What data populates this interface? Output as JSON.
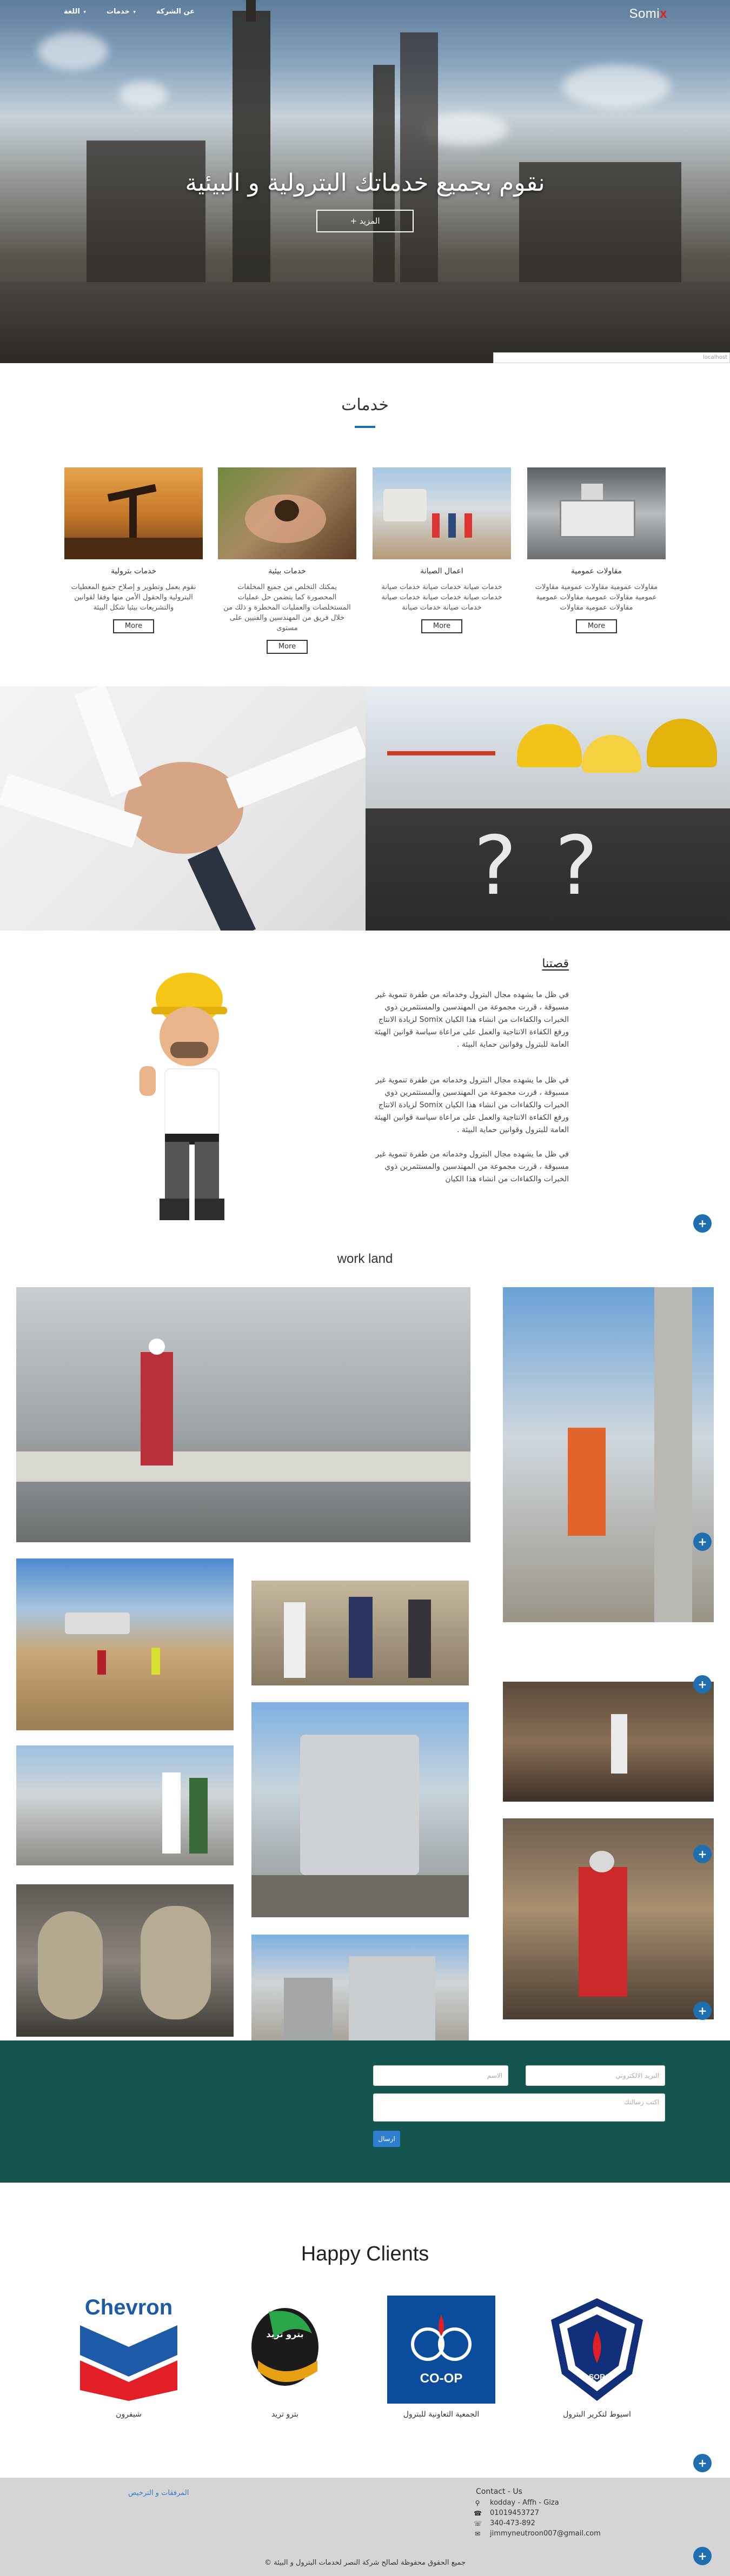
{
  "nav": {
    "items": [
      {
        "label": "اللغة",
        "caret": "▾"
      },
      {
        "label": "خدمات",
        "caret": "▾"
      },
      {
        "label": "عن الشركة",
        "caret": ""
      }
    ],
    "brand_main": "Somi",
    "brand_accent": "x"
  },
  "hero": {
    "title": "نقوم بجميع خدماتك البترولية و البيئية",
    "button_label": "المزيد",
    "button_icon": "+",
    "input_text": "localhost"
  },
  "services": {
    "title": "خدمات",
    "more_label": "More",
    "items": [
      {
        "name": "خدمات بترولية",
        "desc": "نقوم بعمل وتطوير و إصلاح جميع المعطيات البترولية والحقول الأمن منها وفقا لقوانين والتشريعات بيئيا شكل البيئة",
        "image": "oil-pumpjack"
      },
      {
        "name": "خدمات بيئية",
        "desc": "يمكنك التخلص من جميع المخلفات المحصورة كما يتضمن حل عمليات المستخلصات والعمليات المحطرة و ذلك من خلال فريق من المهندسين والفنيين على مستوى",
        "image": "hands-soil"
      },
      {
        "name": "اعمال الصيانة",
        "desc": "خدمات صيانة خدمات صيانة خدمات صيانة خدمات صيانة خدمات صيانة خدمات صيانة خدمات صيانة خدمات صيانة",
        "image": "maintenance-team"
      },
      {
        "name": "مقاولات عمومية",
        "desc": "مقاولات عمومية مقاولات عمومية مقاولات عمومية مقاولات عمومية مقاولات عمومية مقاولات عمومية مقاولات",
        "image": "workshop"
      }
    ]
  },
  "story": {
    "title": "قصتنا",
    "paragraph1": "في ظل ما يشهده مجال البترول وخدماته من طفرة تنموية غير مسبوقة ، قررت مجموعة من المهندسين والمستثمرين ذوي الخبرات والكفاءات من انشاء هذا الكيان Somix لزيادة الانتاج ورفع الكفاءة الانتاجية والعمل على مراعاة سياسة قوانين الهيئة العامة للبترول وقوانين حماية البيئة .",
    "paragraph2": "في ظل ما يشهده مجال البترول وخدماته من طفرة تنموية غير مسبوقة ، قررت مجموعة من المهندسين والمستثمرين ذوي الخبرات والكفاءات من انشاء هذا الكيان Somix لزيادة الانتاج ورفع الكفاءة الانتاجية والعمل على مراعاة سياسة قوانين الهيئة العامة للبترول وقوانين حماية البيئة .",
    "paragraph3": "في ظل ما يشهده مجال البترول وخدماته من طفرة تنموية غير مسبوقة ، قررت مجموعة من المهندسين والمستثمرين ذوي الخبرات والكفاءات من انشاء هذا الكيان"
  },
  "work": {
    "title": "work land"
  },
  "fab_icon": "+",
  "form": {
    "name_placeholder": "الاسم",
    "email_placeholder": "البريد الالكتروني",
    "message_placeholder": "اكتب رسالتك",
    "submit_label": "ارسال"
  },
  "clients": {
    "title": "Happy Clients",
    "items": [
      {
        "name": "شيفرون",
        "logo": "chevron-logo"
      },
      {
        "name": "بترو تريد",
        "logo": "petrotrade-logo"
      },
      {
        "name": "الجمعية التعاونية للبترول",
        "logo": "coop-logo"
      },
      {
        "name": "اسيوط لتكرير البترول",
        "logo": "asorc-logo"
      }
    ],
    "chevron_word": "Chevron",
    "petrotrade_word": "بترو تريد",
    "coop_word": "CO-OP",
    "asorc_word": "ASORC"
  },
  "footer": {
    "links": "المرفقات و الترخيص",
    "contact_title": "Contact - Us",
    "address": "kodday - Affh - Giza",
    "phone1": "01019453727",
    "phone2": "340-473-892",
    "email": "jimmyneutroon007@gmail.com",
    "copyright": "جميع الحقوق محفوظة لصالح شركة النصر لخدمات البترول و البيئة"
  },
  "colors": {
    "accent_blue": "#1f6fb0",
    "form_bg": "#155550",
    "brand_red": "#e0221a",
    "footer_bg": "#d5d5d5"
  }
}
